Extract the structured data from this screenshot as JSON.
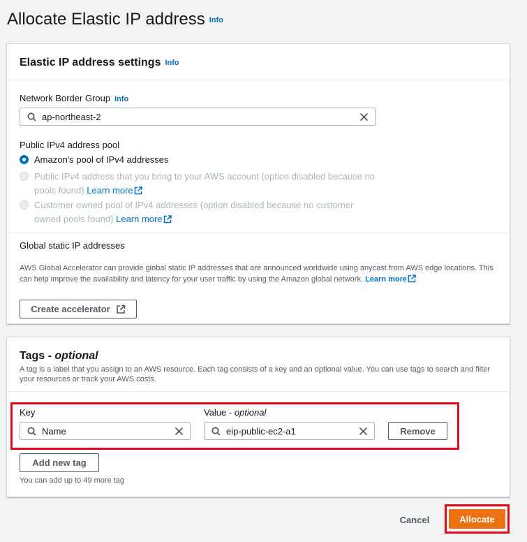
{
  "page": {
    "title": "Allocate Elastic IP address",
    "info": "Info"
  },
  "settings": {
    "title": "Elastic IP address settings",
    "info": "Info",
    "border_group": {
      "label": "Network Border Group",
      "info": "Info",
      "value": "ap-northeast-2"
    },
    "pool": {
      "label": "Public IPv4 address pool",
      "options": [
        {
          "label": "Amazon's pool of IPv4 addresses",
          "selected": true,
          "disabled": false
        },
        {
          "line1": "Public IPv4 address that you bring to your AWS account (option disabled because no",
          "line2": "pools found)",
          "link": "Learn more",
          "selected": false,
          "disabled": true
        },
        {
          "line1": "Customer owned pool of IPv4 addresses (option disabled because no customer",
          "line2": "owned pools found)",
          "link": "Learn more",
          "selected": false,
          "disabled": true
        }
      ]
    },
    "global": {
      "label": "Global static IP addresses",
      "desc_line1": "AWS Global Accelerator can provide global static IP addresses that are announced worldwide using anycast from AWS edge locations. This",
      "desc_line2": "can help improve the availability and latency for your user traffic by using the Amazon global network.",
      "link": "Learn more",
      "button": "Create accelerator"
    }
  },
  "tags": {
    "title": "Tags - ",
    "title_optional": "optional",
    "desc_line1": "A tag is a label that you assign to an AWS resource. Each tag consists of a key and an optional value. You can use tags to search and filter",
    "desc_line2": "your resources or track your AWS costs.",
    "key_label": "Key",
    "value_label": "Value - ",
    "value_optional": "optional",
    "rows": [
      {
        "key": "Name",
        "value": "eip-public-ec2-a1",
        "remove": "Remove"
      }
    ],
    "add_button": "Add new tag",
    "limit_text": "You can add up to 49 more tag"
  },
  "footer": {
    "cancel": "Cancel",
    "allocate": "Allocate"
  },
  "colors": {
    "accent": "#0073bb",
    "primary": "#ec7211",
    "highlight": "#e00b1c"
  }
}
